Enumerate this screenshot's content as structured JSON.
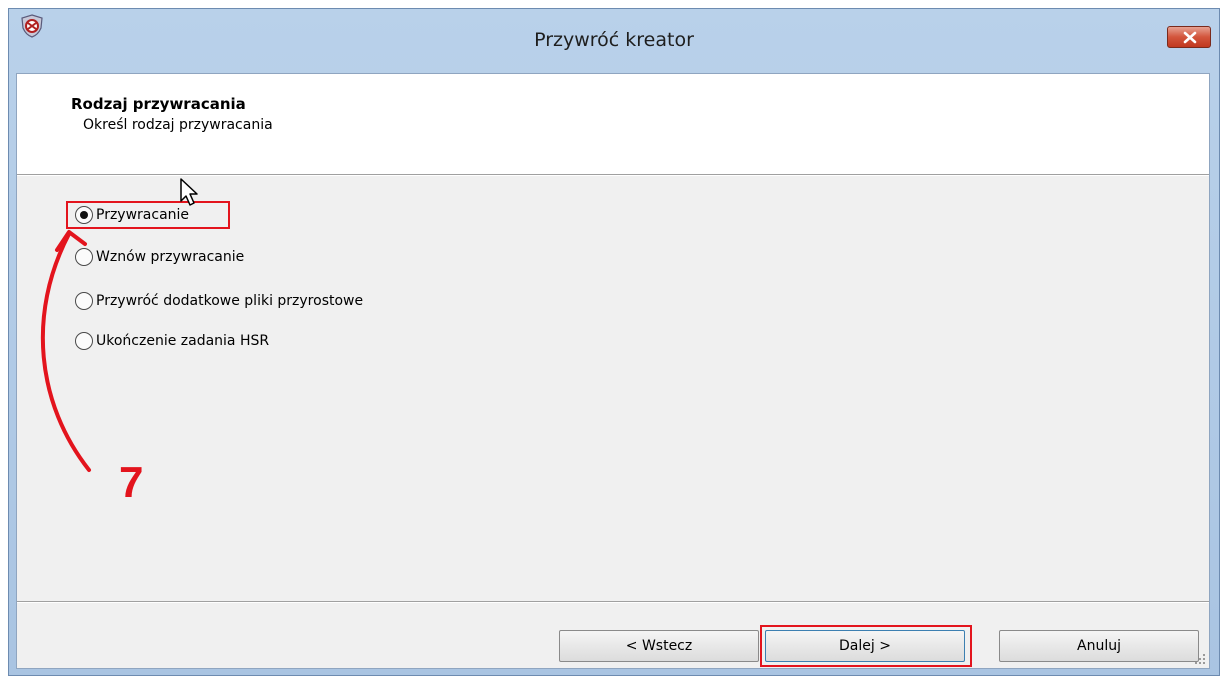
{
  "window": {
    "title": "Przywróć kreator"
  },
  "header": {
    "title": "Rodzaj przywracania",
    "subtitle": "Określ rodzaj przywracania"
  },
  "options": [
    {
      "label": "Przywracanie",
      "checked": true
    },
    {
      "label": "Wznów przywracanie",
      "checked": false
    },
    {
      "label": "Przywróć dodatkowe pliki przyrostowe",
      "checked": false
    },
    {
      "label": "Ukończenie zadania HSR",
      "checked": false
    }
  ],
  "annotation": {
    "step": "7",
    "color": "#e3141d"
  },
  "buttons": {
    "back": "< Wstecz",
    "next": "Dalej >",
    "cancel": "Anuluj"
  },
  "colors": {
    "title_bar": "#b9d1ea",
    "client_bg": "#f0f0f0",
    "header_bg": "#ffffff",
    "close_button": "#d3553c"
  },
  "icons": {
    "app": "app-shield-icon",
    "close": "close-icon",
    "cursor": "mouse-cursor-icon",
    "grip": "resize-grip-icon"
  }
}
